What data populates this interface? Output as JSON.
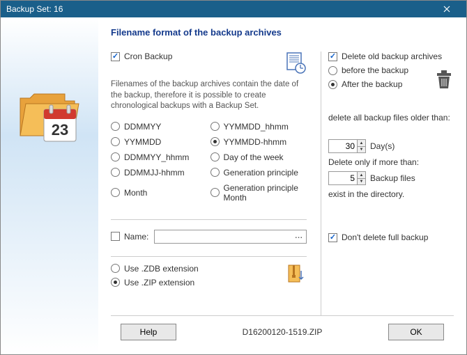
{
  "titlebar": {
    "title": "Backup Set: 16"
  },
  "heading": "Filename format of the backup archives",
  "cron": {
    "label": "Cron Backup",
    "checked": true
  },
  "desc": "Filenames of the backup archives contain the date of the backup, therefore it is possible to create chronological backups with a Backup Set.",
  "formats": {
    "ddmmyy": "DDMMYY",
    "yymmdd": "YYMMDD",
    "ddmmyy_hhmm": "DDMMYY_hhmm",
    "ddmmjj_hhmm": "DDMMJJ-hhmm",
    "month": "Month",
    "yymmdd_hhmm": "YYMMDD_hhmm",
    "yymmdd_hhmm2": "YYMMDD-hhmm",
    "dayofweek": "Day of the week",
    "genprinc": "Generation principle",
    "genprincmonth": "Generation principle Month",
    "selected": "yymmdd_hhmm2"
  },
  "name": {
    "label": "Name:",
    "value": "",
    "btn": "..."
  },
  "ext": {
    "zdb": "Use .ZDB extension",
    "zip": "Use .ZIP extension",
    "selected": "zip"
  },
  "deleteOld": {
    "label": "Delete old backup archives",
    "checked": true,
    "before": "before the backup",
    "after": "After the backup",
    "selected": "after"
  },
  "olderThan": {
    "prompt": "delete all backup files older than:",
    "days": 30,
    "days_unit": "Day(s)",
    "moreThan": "Delete only if more than:",
    "files": 5,
    "files_unit": "Backup files",
    "exists": "exist in the directory."
  },
  "dontDeleteFull": {
    "label": "Don't delete full backup",
    "checked": true
  },
  "footer": {
    "help": "Help",
    "filename": "D16200120-1519.ZIP",
    "ok": "OK"
  }
}
